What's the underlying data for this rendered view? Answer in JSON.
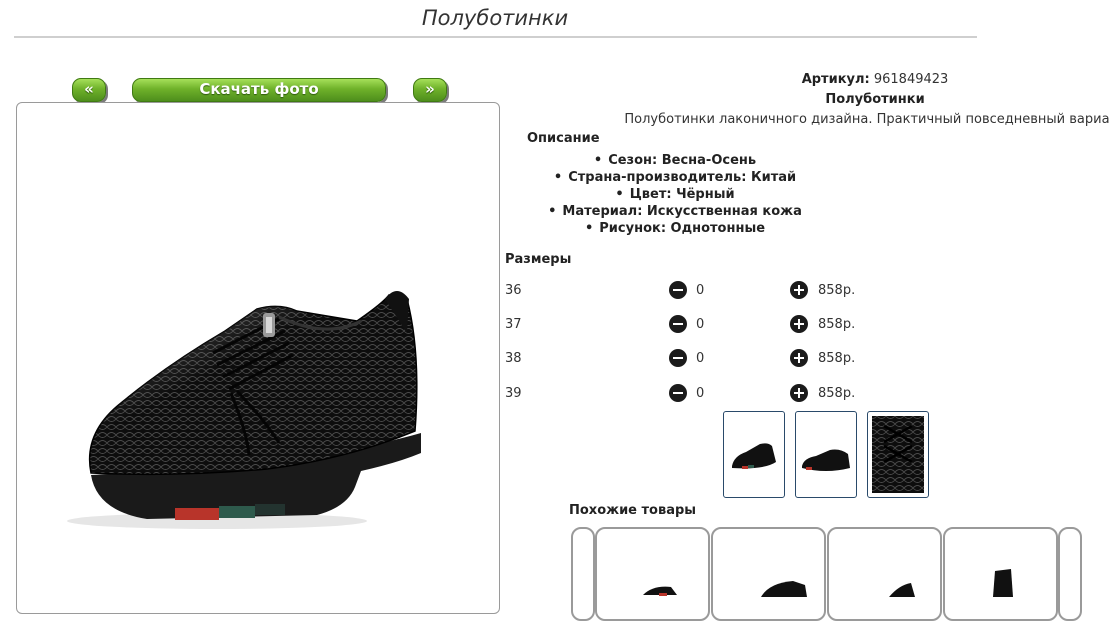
{
  "page": {
    "title": "Полуботинки"
  },
  "photo_nav": {
    "prev": "«",
    "download": "Скачать фото",
    "next": "»"
  },
  "product": {
    "article_label": "Артикул:",
    "article_value": "961849423",
    "name": "Полуботинки",
    "description": "Полуботинки лаконичного дизайна. Практичный повседневный вариант",
    "description_heading": "Описание",
    "attributes": [
      "Сезон: Весна-Осень",
      "Страна-производитель: Китай",
      "Цвет: Чёрный",
      "Материал: Искусственная кожа",
      "Рисунок: Однотонные"
    ]
  },
  "sizes": {
    "heading": "Размеры",
    "rows": [
      {
        "size": "36",
        "qty": "0",
        "price": "858р."
      },
      {
        "size": "37",
        "qty": "0",
        "price": "858р."
      },
      {
        "size": "38",
        "qty": "0",
        "price": "858р."
      },
      {
        "size": "39",
        "qty": "0",
        "price": "858р."
      }
    ]
  },
  "thumbnails": [
    "shoe-side-thumb",
    "shoe-angle-thumb",
    "shoe-texture-thumb"
  ],
  "similar": {
    "heading": "Похожие товары"
  },
  "icons": {
    "minus": "minus-circle-icon",
    "plus": "plus-circle-icon"
  },
  "colors": {
    "button_green": "#6fb22a",
    "border": "#9a9a9a",
    "thumb_border": "#2a4a6a"
  }
}
